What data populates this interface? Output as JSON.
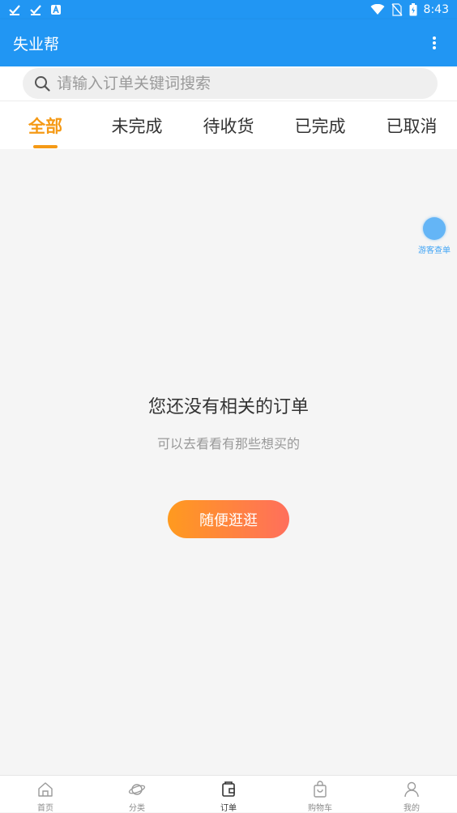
{
  "status_bar": {
    "time": "8:43"
  },
  "app_bar": {
    "title": "失业帮"
  },
  "search": {
    "placeholder": "请输入订单关键词搜索",
    "value": ""
  },
  "tabs": [
    {
      "label": "全部",
      "active": true
    },
    {
      "label": "未完成",
      "active": false
    },
    {
      "label": "待收货",
      "active": false
    },
    {
      "label": "已完成",
      "active": false
    },
    {
      "label": "已取消",
      "active": false
    }
  ],
  "floating": {
    "guest_orders_label": "游客查单"
  },
  "empty_state": {
    "title": "您还没有相关的订单",
    "subtitle": "可以去看看有那些想买的",
    "button_label": "随便逛逛"
  },
  "bottom_nav": [
    {
      "label": "首页",
      "icon": "home-icon",
      "active": false
    },
    {
      "label": "分类",
      "icon": "planet-icon",
      "active": false
    },
    {
      "label": "订单",
      "icon": "order-icon",
      "active": true
    },
    {
      "label": "购物车",
      "icon": "cart-bag-icon",
      "active": false
    },
    {
      "label": "我的",
      "icon": "user-icon",
      "active": false
    }
  ],
  "colors": {
    "primary": "#2196f3",
    "accent": "#f59a16",
    "button_gradient_start": "#ff9a1f",
    "button_gradient_end": "#ff6f5c"
  }
}
